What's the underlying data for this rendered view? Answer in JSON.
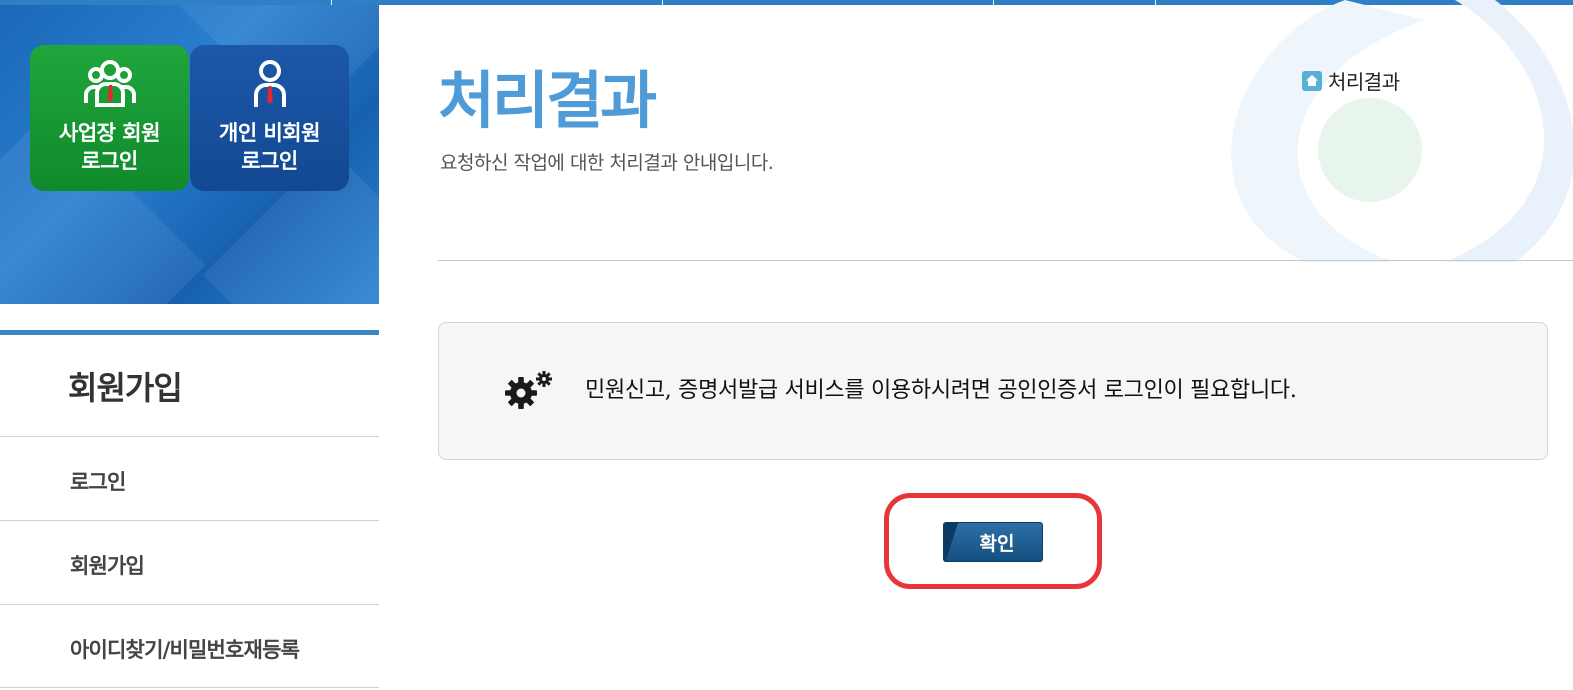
{
  "sidebar": {
    "login_buttons": [
      {
        "label": "사업장 회원\n로그인",
        "icon": "business-members-icon",
        "color": "#129130"
      },
      {
        "label": "개인 비회원\n로그인",
        "icon": "person-icon",
        "color": "#164c98"
      }
    ],
    "nav_title": "회원가입",
    "nav_items": [
      {
        "label": "로그인"
      },
      {
        "label": "회원가입"
      },
      {
        "label": "아이디찾기/비밀번호재등록"
      }
    ]
  },
  "main": {
    "title": "처리결과",
    "subtitle": "요청하신 작업에 대한 처리결과 안내입니다.",
    "breadcrumb": {
      "icon": "home-icon",
      "label": "처리결과"
    },
    "notice": {
      "icon": "gear-icon",
      "message": "민원신고, 증명서발급 서비스를 이용하시려면 공인인증서 로그인이 필요합니다."
    },
    "confirm_label": "확인"
  },
  "colors": {
    "accent_blue": "#4f9bd8",
    "banner_blue": "#1f6fbf",
    "highlight_red": "#e8353a"
  }
}
